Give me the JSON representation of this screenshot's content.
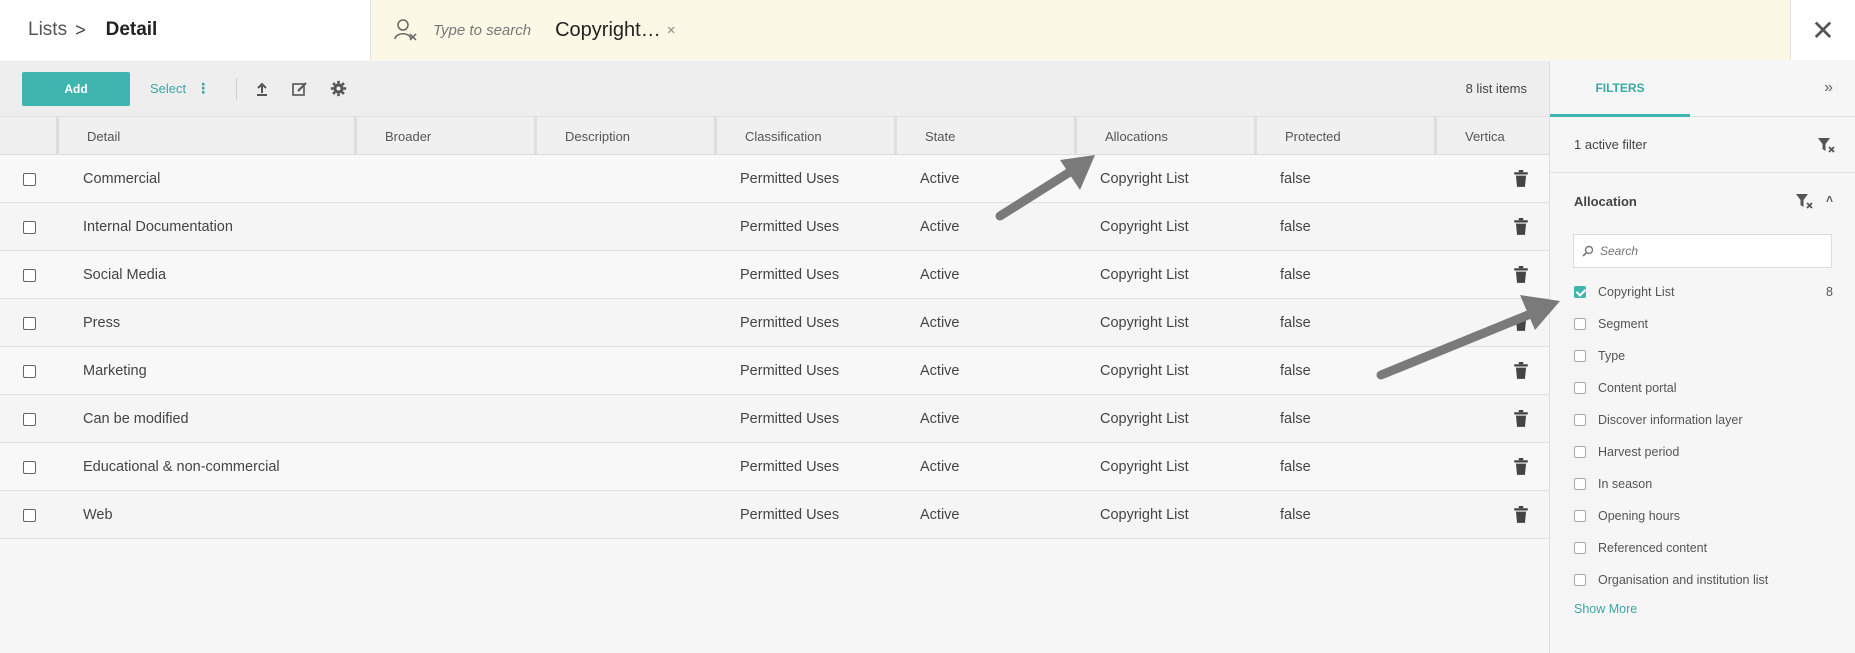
{
  "breadcrumb": {
    "parent": "Lists",
    "separator": ">",
    "current": "Detail"
  },
  "search": {
    "placeholder": "Type to search",
    "chip_label": "Copyright…",
    "chip_remove": "×"
  },
  "close_label": "✕",
  "toolbar": {
    "add_label": "Add",
    "select_label": "Select",
    "select_more": "⋮",
    "item_count": "8 list items"
  },
  "table": {
    "columns": [
      "Detail",
      "Broader",
      "Description",
      "Classification",
      "State",
      "Allocations",
      "Protected",
      "Vertica"
    ],
    "rows": [
      {
        "detail": "Commercial",
        "classification": "Permitted Uses",
        "state": "Active",
        "allocations": "Copyright List",
        "protected": "false"
      },
      {
        "detail": "Internal Documentation",
        "classification": "Permitted Uses",
        "state": "Active",
        "allocations": "Copyright List",
        "protected": "false"
      },
      {
        "detail": "Social Media",
        "classification": "Permitted Uses",
        "state": "Active",
        "allocations": "Copyright List",
        "protected": "false"
      },
      {
        "detail": "Press",
        "classification": "Permitted Uses",
        "state": "Active",
        "allocations": "Copyright List",
        "protected": "false"
      },
      {
        "detail": "Marketing",
        "classification": "Permitted Uses",
        "state": "Active",
        "allocations": "Copyright List",
        "protected": "false"
      },
      {
        "detail": "Can be modified",
        "classification": "Permitted Uses",
        "state": "Active",
        "allocations": "Copyright List",
        "protected": "false"
      },
      {
        "detail": "Educational & non-commercial",
        "classification": "Permitted Uses",
        "state": "Active",
        "allocations": "Copyright List",
        "protected": "false"
      },
      {
        "detail": "Web",
        "classification": "Permitted Uses",
        "state": "Active",
        "allocations": "Copyright List",
        "protected": "false"
      }
    ]
  },
  "filters": {
    "tab_label": "FILTERS",
    "expand_label": "»",
    "active_text": "1 active filter",
    "section_title": "Allocation",
    "collapse_label": "˄",
    "search_placeholder": "Search",
    "options": [
      {
        "label": "Copyright List",
        "checked": true,
        "count": "8"
      },
      {
        "label": "Segment",
        "checked": false,
        "count": ""
      },
      {
        "label": "Type",
        "checked": false,
        "count": ""
      },
      {
        "label": "Content portal",
        "checked": false,
        "count": ""
      },
      {
        "label": "Discover information layer",
        "checked": false,
        "count": ""
      },
      {
        "label": "Harvest period",
        "checked": false,
        "count": ""
      },
      {
        "label": "In season",
        "checked": false,
        "count": ""
      },
      {
        "label": "Opening hours",
        "checked": false,
        "count": ""
      },
      {
        "label": "Referenced content",
        "checked": false,
        "count": ""
      },
      {
        "label": "Organisation and institution list",
        "checked": false,
        "count": ""
      }
    ],
    "show_more": "Show More"
  },
  "colors": {
    "accent": "#40b5b0",
    "search_bg": "#fbf9e6",
    "arrow": "#7a7a7a"
  }
}
